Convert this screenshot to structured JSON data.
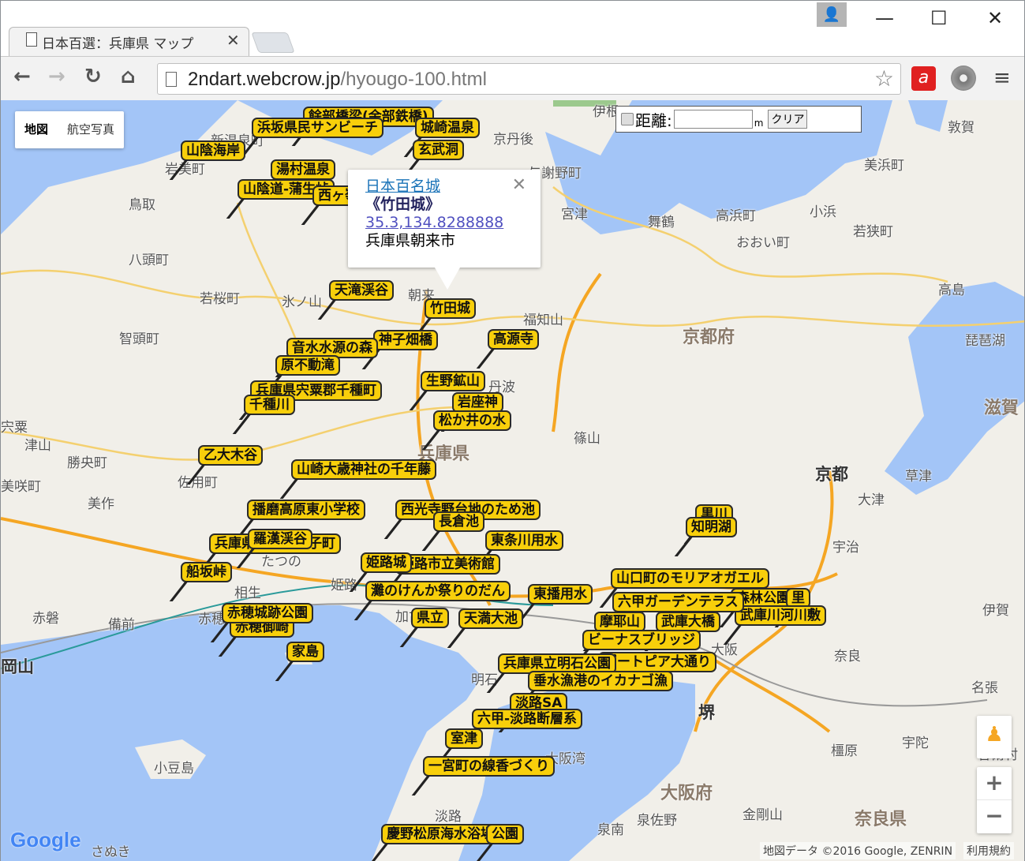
{
  "browser": {
    "tab_title": "日本百選：兵庫県 マップ",
    "url_host": "2ndart.webcrow.jp",
    "url_path": "/hyougo-100.html"
  },
  "map_type": {
    "map": "地図",
    "satellite": "航空写真"
  },
  "distance": {
    "label": "距離:",
    "value": "",
    "unit": "m",
    "clear": "クリア"
  },
  "info_window": {
    "category": "日本百名城",
    "name": "《竹田城》",
    "coords": "35.3,134.8288888",
    "address": "兵庫県朝来市"
  },
  "markers": [
    "餘部橋梁(余部鉄橋)",
    "浜坂県民サンビーチ",
    "山陰海岸",
    "城崎温泉",
    "玄武洞",
    "湯村温泉",
    "山陰道-蒲生峠",
    "西ヶ嶺",
    "天滝渓谷",
    "竹田城",
    "神子畑橋",
    "高源寺",
    "音水水源の森",
    "原不動滝",
    "兵庫県宍粟郡千種町",
    "千種川",
    "生野鉱山",
    "岩座神",
    "松か井の水",
    "乙大木谷",
    "山崎大歳神社の千年藤",
    "播磨高原東小学校",
    "西光寺野台地のため池",
    "長倉池",
    "東条川用水",
    "兵庫県揖保郡太子町",
    "羅漢渓谷",
    "船坂峠",
    "姫路市立美術館",
    "姫路城",
    "灘のけんか祭りのだん",
    "東播用水",
    "県立",
    "天満大池",
    "赤穂御崎",
    "赤穂城跡公園",
    "家島",
    "森林公園",
    "里",
    "山口町のモリアオガエル",
    "武庫川河川敷",
    "六甲ガーデンテラス",
    "摩耶山",
    "武庫大橋",
    "ビーナスブリッジ",
    "ポートピア大通り",
    "兵庫県立明石公園",
    "垂水漁港のイカナゴ漁",
    "淡路SA",
    "六甲-淡路断層系",
    "室津",
    "一宮町の線香づくり",
    "慶野松原海水浴場",
    "公園",
    "黒川",
    "知明湖"
  ],
  "places": [
    "鳥取",
    "岩美町",
    "新温泉町",
    "八頭町",
    "若桜町",
    "智頭町",
    "氷ノ山",
    "朝来",
    "福知山",
    "京丹後",
    "与謝野町",
    "宮津",
    "舞鶴",
    "高浜町",
    "おおい町",
    "小浜",
    "若狭町",
    "美浜町",
    "敦賀",
    "高島",
    "琵琶湖",
    "京都府",
    "丹波",
    "篠山",
    "兵庫県",
    "宍粟",
    "津山",
    "勝央町",
    "美咲町",
    "美作",
    "佐用町",
    "たつの",
    "相生",
    "赤磐",
    "備前",
    "赤穂",
    "姫路",
    "加古川",
    "明石",
    "京都",
    "大津",
    "草津",
    "宇治",
    "滋賀",
    "奈良",
    "伊賀",
    "名張",
    "宇陀",
    "橿原",
    "大阪府",
    "大阪",
    "堺",
    "泉佐野",
    "泉南",
    "金剛山",
    "奈良県",
    "淡路",
    "小豆島",
    "大阪湾",
    "さぬき",
    "曽爾村",
    "伊根",
    "岡山"
  ],
  "attribution": "地図データ ©2016 Google, ZENRIN",
  "terms": "利用規約",
  "google_logo": "Google",
  "colors": {
    "marker": "#f8cf0b",
    "sea": "#a3c5f7",
    "land": "#f1efe9",
    "road": "#f5a623"
  }
}
